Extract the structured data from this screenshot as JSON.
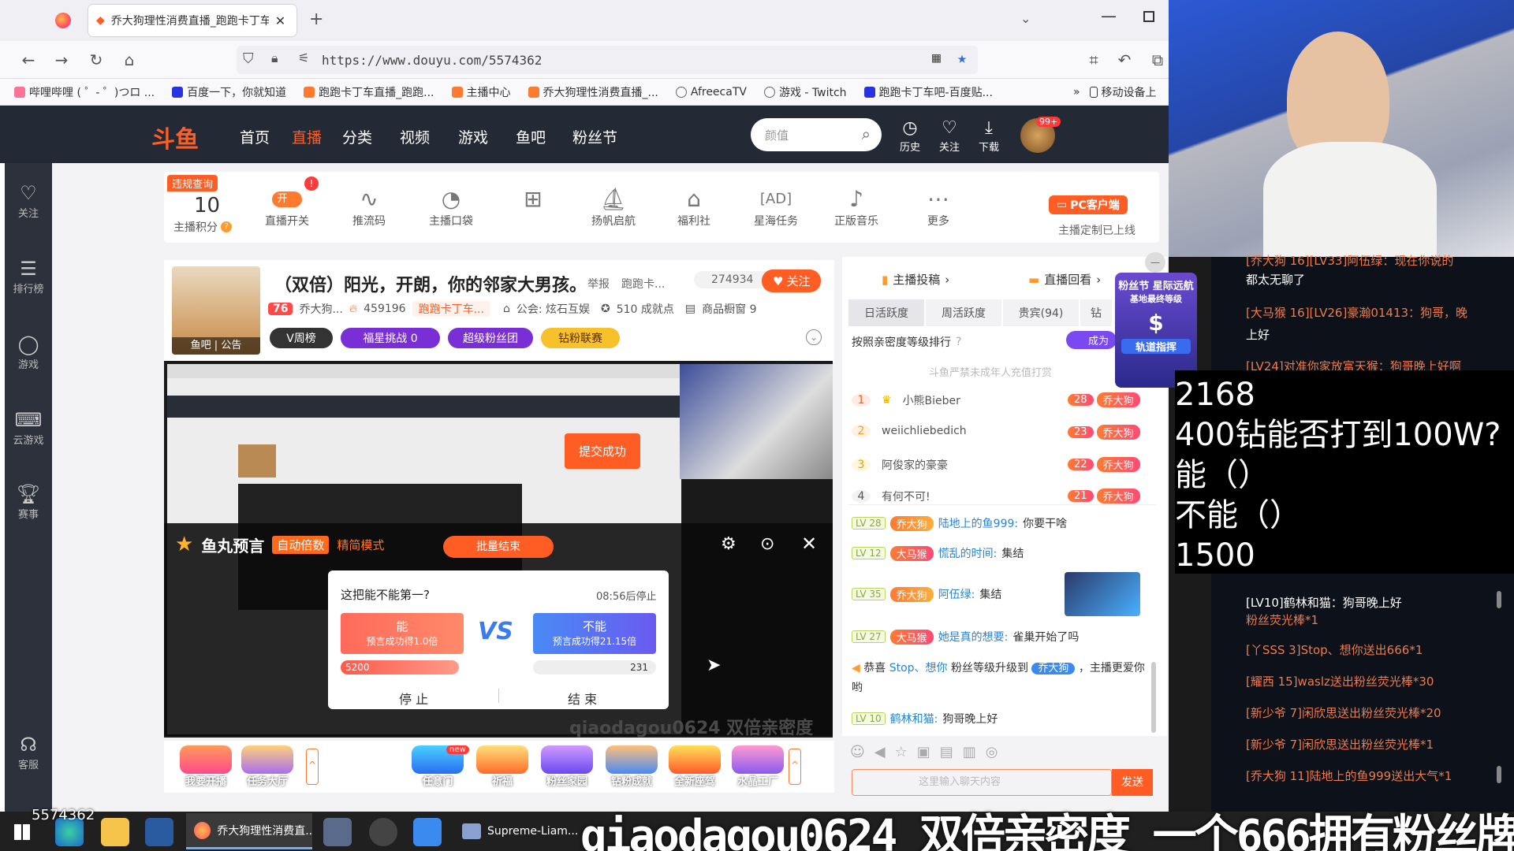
{
  "browser": {
    "tab_title": "乔大狗理性消费直播_跑跑卡丁车",
    "url": "https://www.douyu.com/5574362",
    "bookmarks": [
      "哔哩哔哩 ( ゜- ゜)つロ ...",
      "百度一下，你就知道",
      "跑跑卡丁车直播_跑跑...",
      "主播中心",
      "乔大狗理性消费直播_...",
      "AfreecaTV",
      "游戏 - Twitch",
      "跑跑卡丁车吧-百度贴...",
      "移动设备上"
    ]
  },
  "douyu": {
    "logo": "斗鱼",
    "nav": [
      "首页",
      "直播",
      "分类",
      "视频",
      "游戏",
      "鱼吧",
      "粉丝节"
    ],
    "search_placeholder": "颜值",
    "header_icons": [
      {
        "label": "历史",
        "icon": "clock-icon"
      },
      {
        "label": "关注",
        "icon": "heart-icon"
      },
      {
        "label": "下载",
        "icon": "download-icon"
      }
    ],
    "avatar_badge": "99+",
    "sidebar": [
      {
        "label": "关注",
        "icon": "heart-icon"
      },
      {
        "label": "排行榜",
        "icon": "rank-icon"
      },
      {
        "label": "游戏",
        "icon": "game-icon"
      },
      {
        "label": "云游戏",
        "icon": "controller-icon"
      },
      {
        "label": "赛事",
        "icon": "trophy-icon"
      },
      {
        "label": "客服",
        "icon": "headset-icon"
      }
    ],
    "toolbar": {
      "violation_query": "违规查询",
      "score_value": "10",
      "score_label": "主播积分",
      "live_toggle_label": "直播开关",
      "live_toggle_state": "开",
      "items": [
        {
          "label": "推流码",
          "icon": "pulse-icon"
        },
        {
          "label": "主播口袋",
          "icon": "pocket-icon"
        },
        {
          "label": "",
          "icon": "gift-icon"
        },
        {
          "label": "扬帆启航",
          "icon": "sail-icon"
        },
        {
          "label": "福利社",
          "icon": "shop-icon"
        },
        {
          "label": "星海任务",
          "icon": "ad-icon"
        },
        {
          "label": "正版音乐",
          "icon": "music-icon"
        },
        {
          "label": "更多",
          "icon": "more-icon"
        }
      ],
      "pc_client": "PC客户端",
      "custom_online": "主播定制已上线"
    },
    "room": {
      "title": "（双倍）阳光，开朗，你的邻家大男孩。",
      "report": "举报",
      "category": "跑跑卡...",
      "viewers": "274934",
      "follow": "关注",
      "level": "76",
      "anchor_name": "乔大狗...",
      "hot": "459196",
      "tag": "跑跑卡丁车...",
      "union": "公会: 炫石互娱",
      "achievements": "510 成就点",
      "products": "商品橱窗 9",
      "avatar_tabs": "鱼吧 | 公告",
      "pills": [
        "V周榜",
        "福星挑战  0",
        "超级粉丝团",
        "钻粉联赛"
      ]
    },
    "prediction": {
      "title": "鱼丸预言",
      "auto_double": "自动倍数",
      "mode": "精简模式",
      "batch_end": "批量结束",
      "question": "这把能不能第一?",
      "countdown": "08:56后停止",
      "option_yes": "能",
      "option_yes_sub": "预言成功得1.0倍",
      "option_no": "不能",
      "option_no_sub": "预言成功得21.15倍",
      "yes_amount": "5200",
      "no_amount": "231",
      "stop": "停 止",
      "end": "结 束",
      "submit": "提交成功",
      "stream_text": "qiaodagou0624  双倍亲密度"
    },
    "right_panel": {
      "tabs_top": [
        "主播投稿",
        "直播回看"
      ],
      "tabs": [
        "日活跃度",
        "周活跃度",
        "贵宾(94)",
        "钻"
      ],
      "sort_label": "按照亲密度等级排行",
      "notice": "斗鱼严禁未成年人充值打赏",
      "ranking": [
        {
          "rank": "1",
          "name": "小熊Bieber",
          "badge": "28"
        },
        {
          "rank": "2",
          "name": "weiichliebedich",
          "badge": "23"
        },
        {
          "rank": "3",
          "name": "阿俊家的豪豪",
          "badge": "22"
        },
        {
          "rank": "4",
          "name": "有何不可!",
          "badge": "21"
        }
      ],
      "badge_name": "乔大狗",
      "chat": [
        {
          "lv": "LV 28",
          "badge": "乔大狗",
          "name": "陆地上的鱼999:",
          "msg": "你要干啥"
        },
        {
          "lv": "LV 12",
          "badge": "大马猴",
          "name": "慌乱的时间:",
          "msg": "集结"
        },
        {
          "lv": "LV 35",
          "badge": "乔大狗",
          "name": "阿伍绿:",
          "msg": "集结"
        },
        {
          "lv": "LV 27",
          "badge": "大马猴",
          "name": "她是真的想要:",
          "msg": "雀巢开始了吗"
        },
        {
          "lv": "LV 10",
          "badge": "",
          "name": "鹤林和猫:",
          "msg": "狗哥晚上好"
        }
      ],
      "congrats": {
        "prefix": "恭喜",
        "user": "Stop、想你",
        "mid": "粉丝等级升级到",
        "badge": "乔大狗",
        "suffix": "，主播更爱你哟"
      },
      "input_placeholder": "这里输入聊天内容",
      "send": "发送",
      "float_banner": "粉丝节 星际远航",
      "float_sub": "基地最终等级",
      "float_btn": "轨道指挥",
      "success": "成为"
    },
    "gifts": [
      "我要开播",
      "任务大厅",
      "任意门",
      "祈福",
      "粉丝家园",
      "钻粉成就",
      "全新座驾",
      "水晶工厂"
    ],
    "gift_new": "new"
  },
  "stream_chat": [
    {
      "text": "[乔大狗 16][LV33]阿伍绿：现在你说的",
      "white": false
    },
    {
      "text": "都太无聊了",
      "white": true
    },
    {
      "text": "[大马猴 16][LV26]豪瀚01413：狗哥，晚",
      "white": false
    },
    {
      "text": "上好",
      "white": true
    },
    {
      "text": "[LV24]对准你家放富天猴：狗哥晚上好啊",
      "white": false
    },
    {
      "text": "[LV10]鹤林和猫：狗哥晚上好",
      "white": false
    },
    {
      "text": "粉丝荧光棒*1",
      "white": false
    },
    {
      "text": "[丫SSS 3]Stop、想你送出666*1",
      "white": false
    },
    {
      "text": "[耀西 15]waslz送出粉丝荧光棒*30",
      "white": false
    },
    {
      "text": "[新少爷 7]闲欣思送出粉丝荧光棒*20",
      "white": false
    },
    {
      "text": "[新少爷 7]闲欣思送出粉丝荧光棒*1",
      "white": false
    },
    {
      "text": "[乔大狗 11]陆地上的鱼999送出大气*1",
      "white": false
    }
  ],
  "overlay_lines": [
    "2168",
    "400钻能否打到100W?",
    "能（）",
    "不能（）",
    "1500"
  ],
  "marquee": "qiaodagou0624  双倍亲密度  一个666拥有粉丝牌",
  "room_id": "5574362",
  "taskbar": {
    "app1": "乔大狗理性消费直...",
    "app2": "Supreme-Liam..."
  },
  "colors": {
    "douyu_orange": "#ff5d23",
    "header_bg": "#242a35",
    "accent_blue": "#2b83d3"
  }
}
